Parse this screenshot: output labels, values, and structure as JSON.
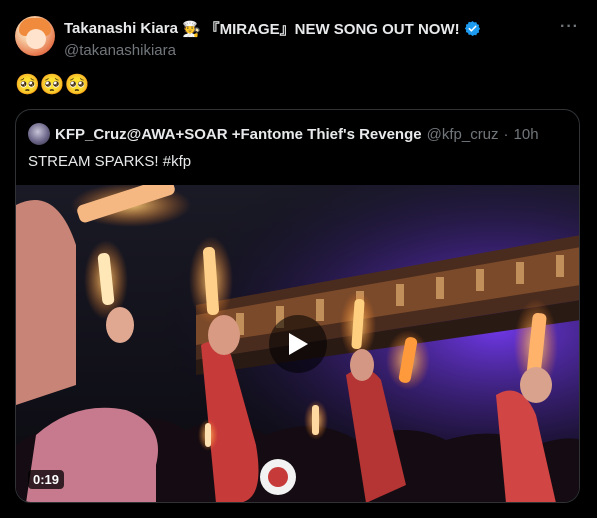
{
  "author": {
    "display_name": "Takanashi Kiara",
    "name_emoji": "🧑‍🍳",
    "name_suffix": "『MIRAGE』NEW SONG OUT NOW!",
    "handle": "@takanashikiara",
    "verified": true,
    "verified_color": "#1d9bf0"
  },
  "tweet": {
    "text": "🥺🥺🥺"
  },
  "more_label": "···",
  "quote": {
    "display_name": "KFP_Cruz@AWA+SOAR +Fantome Thief's Revenge",
    "handle": "@kfp_cruz",
    "separator": "·",
    "time": "10h",
    "text": "STREAM SPARKS! #kfp",
    "video": {
      "duration": "0:19",
      "play_icon": "play-icon"
    }
  },
  "colors": {
    "background": "#000000",
    "text_primary": "#e7e9ea",
    "text_secondary": "#71767b",
    "border": "#2f3336",
    "glow": "#ff9a3c",
    "stage_light": "#6a3cff"
  }
}
